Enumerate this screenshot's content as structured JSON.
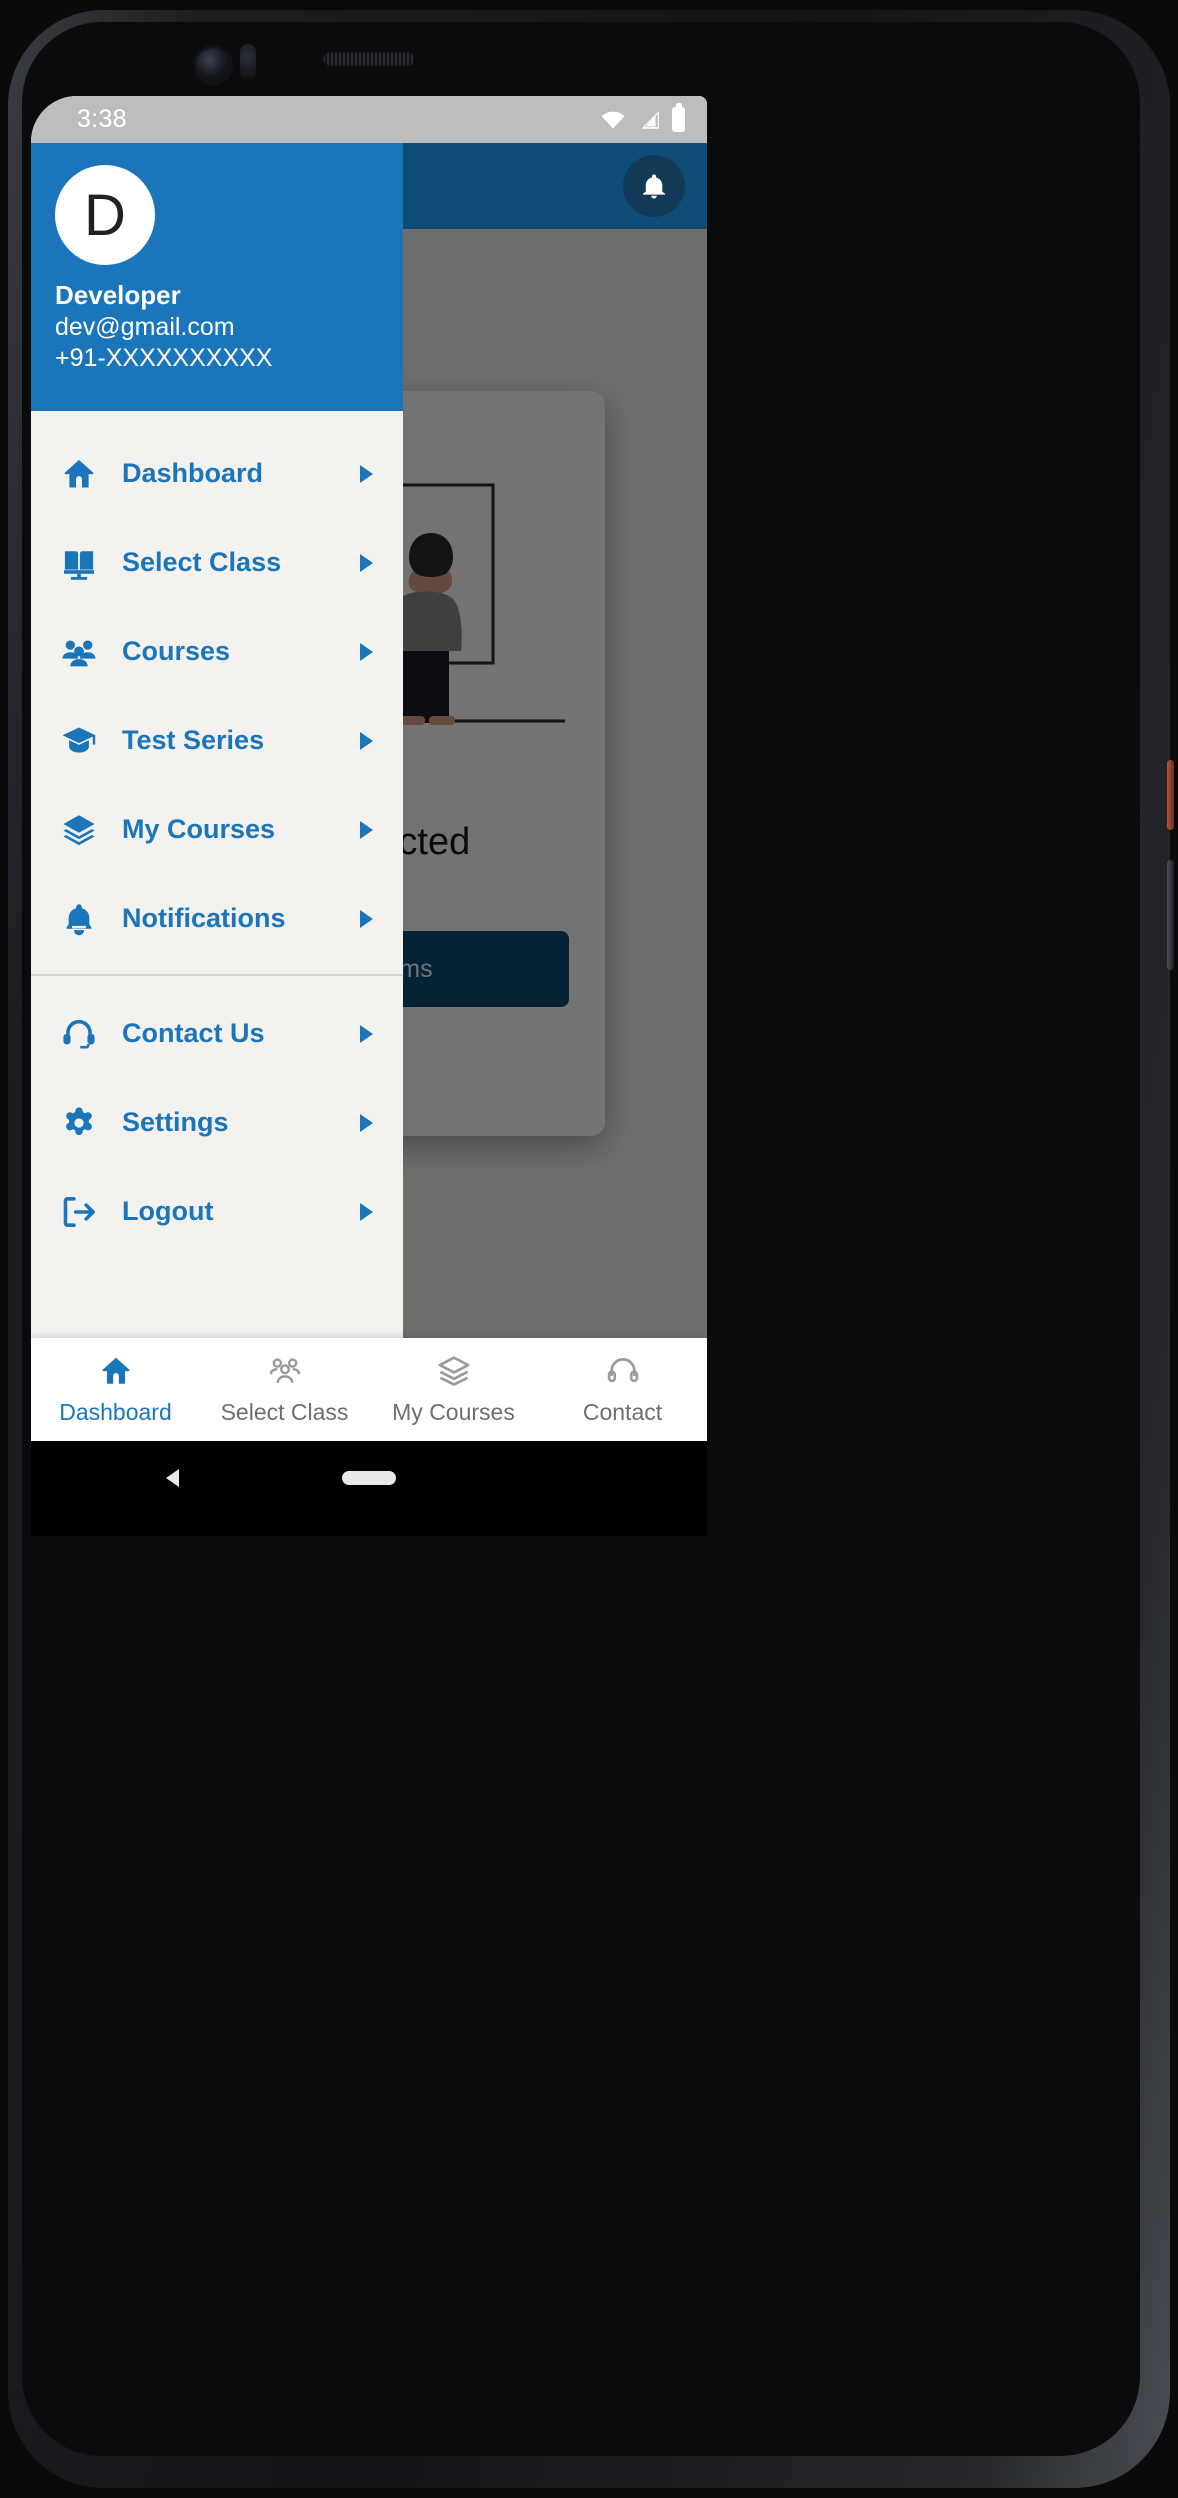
{
  "status_bar": {
    "time": "3:38",
    "icons": [
      "wifi-icon",
      "cellular-signal-icon",
      "battery-icon"
    ]
  },
  "colors": {
    "drawer_header": "#1b75bb",
    "accent_blue": "#1b75bb",
    "appbar_dark": "#0f4c75",
    "drawer_bg": "#f3f2ef",
    "close_red": "#ef3e36",
    "inactive_gray": "#6e6e6e"
  },
  "drawer": {
    "profile": {
      "avatar_initial": "D",
      "name": "Developer",
      "email": "dev@gmail.com",
      "phone": "+91-XXXXXXXXXX"
    },
    "primary_items": [
      {
        "label": "Dashboard",
        "icon": "home-icon"
      },
      {
        "label": "Select Class",
        "icon": "open-book-icon"
      },
      {
        "label": "Courses",
        "icon": "people-group-icon"
      },
      {
        "label": "Test Series",
        "icon": "graduation-cap-icon"
      },
      {
        "label": "My Courses",
        "icon": "layers-icon"
      },
      {
        "label": "Notifications",
        "icon": "bell-icon"
      }
    ],
    "secondary_items": [
      {
        "label": "Contact Us",
        "icon": "headset-icon"
      },
      {
        "label": "Settings",
        "icon": "gear-icon"
      },
      {
        "label": "Logout",
        "icon": "logout-icon"
      }
    ]
  },
  "app": {
    "appbar": {
      "notification_icon": "bell-icon"
    },
    "dialog": {
      "title": "elected",
      "button_label": "ams",
      "close_icon": "close-circle-icon",
      "illustration": "teacher-at-whiteboard-illustration"
    }
  },
  "bottom_nav": {
    "items": [
      {
        "label": "Dashboard",
        "icon": "home-icon",
        "active": true
      },
      {
        "label": "Select Class",
        "icon": "people-group-icon",
        "active": false
      },
      {
        "label": "My Courses",
        "icon": "layers-icon",
        "active": false
      },
      {
        "label": "Contact",
        "icon": "headset-icon",
        "active": false
      }
    ]
  },
  "android_nav": {
    "back_icon": "back-triangle-icon",
    "home_pill": "home-pill-indicator"
  }
}
